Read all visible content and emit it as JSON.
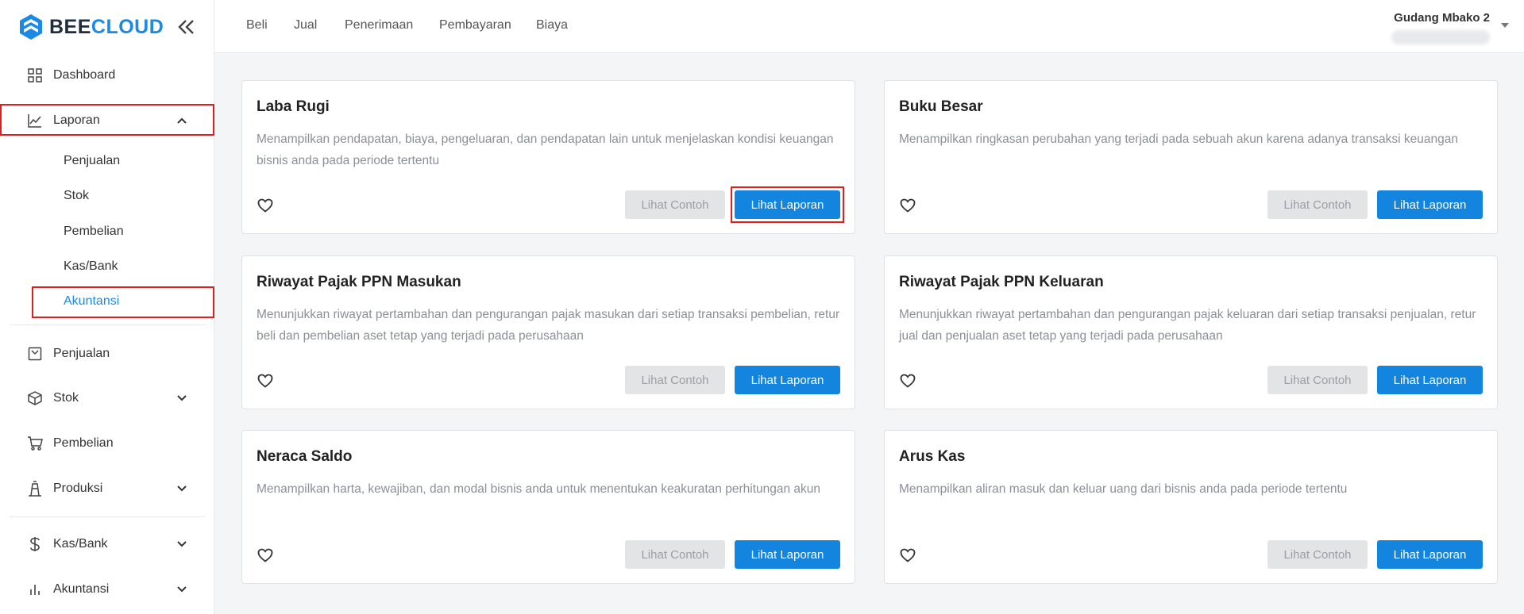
{
  "brand": {
    "name_part1": "BEE",
    "name_part2": "CLOUD"
  },
  "sidebar": {
    "dashboard": "Dashboard",
    "laporan": "Laporan",
    "laporan_sub": [
      "Penjualan",
      "Stok",
      "Pembelian",
      "Kas/Bank",
      "Akuntansi"
    ],
    "penjualan": "Penjualan",
    "stok": "Stok",
    "pembelian": "Pembelian",
    "produksi": "Produksi",
    "kasbank": "Kas/Bank",
    "akuntansi": "Akuntansi"
  },
  "topbar": {
    "links": [
      "Beli",
      "Jual",
      "Penerimaan",
      "Pembayaran",
      "Biaya"
    ],
    "user_name": "Gudang Mbako 2"
  },
  "buttons": {
    "sample": "Lihat Contoh",
    "report": "Lihat Laporan"
  },
  "cards": [
    {
      "title": "Laba Rugi",
      "description": "Menampilkan pendapatan, biaya, pengeluaran, dan pendapatan lain untuk menjelaskan kondisi keuangan bisnis anda pada periode tertentu"
    },
    {
      "title": "Buku Besar",
      "description": "Menampilkan ringkasan perubahan yang terjadi pada sebuah akun karena adanya transaksi keuangan"
    },
    {
      "title": "Riwayat Pajak PPN Masukan",
      "description": "Menunjukkan riwayat pertambahan dan pengurangan pajak masukan dari setiap transaksi pembelian, retur beli dan pembelian aset tetap yang terjadi pada perusahaan"
    },
    {
      "title": "Riwayat Pajak PPN Keluaran",
      "description": "Menunjukkan riwayat pertambahan dan pengurangan pajak keluaran dari setiap transaksi penjualan, retur jual dan penjualan aset tetap yang terjadi pada perusahaan"
    },
    {
      "title": "Neraca Saldo",
      "description": "Menampilkan harta, kewajiban, dan modal bisnis anda untuk menentukan keakuratan perhitungan akun"
    },
    {
      "title": "Arus Kas",
      "description": "Menampilkan aliran masuk dan keluar uang dari bisnis anda pada periode tertentu"
    }
  ],
  "colors": {
    "accent": "#1485de",
    "brand_blue": "#1a8ae5",
    "highlight": "#e01e1e"
  }
}
